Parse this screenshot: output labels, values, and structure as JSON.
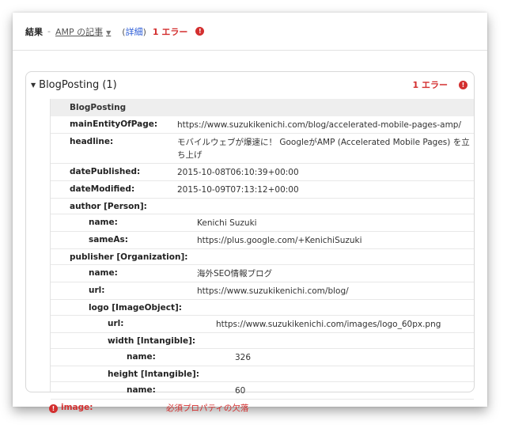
{
  "header": {
    "result_label": "結果",
    "separator": "-",
    "dropdown_label": "AMP の記事",
    "details_open": "(",
    "details_label": "詳細",
    "details_close": ")",
    "error_count": "1 エラー"
  },
  "card": {
    "title": "BlogPosting (1)",
    "error_count": "1 エラー",
    "table_header": "BlogPosting"
  },
  "rows": {
    "mainEntityOfPage": {
      "key": "mainEntityOfPage:",
      "value": "https://www.suzukikenichi.com/blog/accelerated-mobile-pages-amp/"
    },
    "headline": {
      "key": "headline:",
      "value": "モバイルウェブが爆速に！ GoogleがAMP (Accelerated Mobile Pages) を立ち上げ"
    },
    "datePublished": {
      "key": "datePublished:",
      "value": "2015-10-08T06:10:39+00:00"
    },
    "dateModified": {
      "key": "dateModified:",
      "value": "2015-10-09T07:13:12+00:00"
    },
    "author": {
      "key": "author [Person]:"
    },
    "author_name": {
      "key": "name:",
      "value": "Kenichi Suzuki"
    },
    "author_sameAs": {
      "key": "sameAs:",
      "value": "https://plus.google.com/+KenichiSuzuki"
    },
    "publisher": {
      "key": "publisher [Organization]:"
    },
    "publisher_name": {
      "key": "name:",
      "value": "海外SEO情報ブログ"
    },
    "publisher_url": {
      "key": "url:",
      "value": "https://www.suzukikenichi.com/blog/"
    },
    "logo": {
      "key": "logo [ImageObject]:"
    },
    "logo_url": {
      "key": "url:",
      "value": "https://www.suzukikenichi.com/images/logo_60px.png"
    },
    "width": {
      "key": "width [Intangible]:"
    },
    "width_name": {
      "key": "name:",
      "value": "326"
    },
    "height": {
      "key": "height [Intangible]:"
    },
    "height_name": {
      "key": "name:",
      "value": "60"
    },
    "image_error": {
      "key": "image:",
      "value": "必須プロパティの欠落"
    }
  },
  "colors": {
    "error": "#d32f2f",
    "link": "#2a5bd7",
    "header_bg": "#eeeeee"
  },
  "icons": {
    "error": "error-circle-icon",
    "expand": "triangle-down-icon",
    "dropdown": "caret-down-icon"
  }
}
